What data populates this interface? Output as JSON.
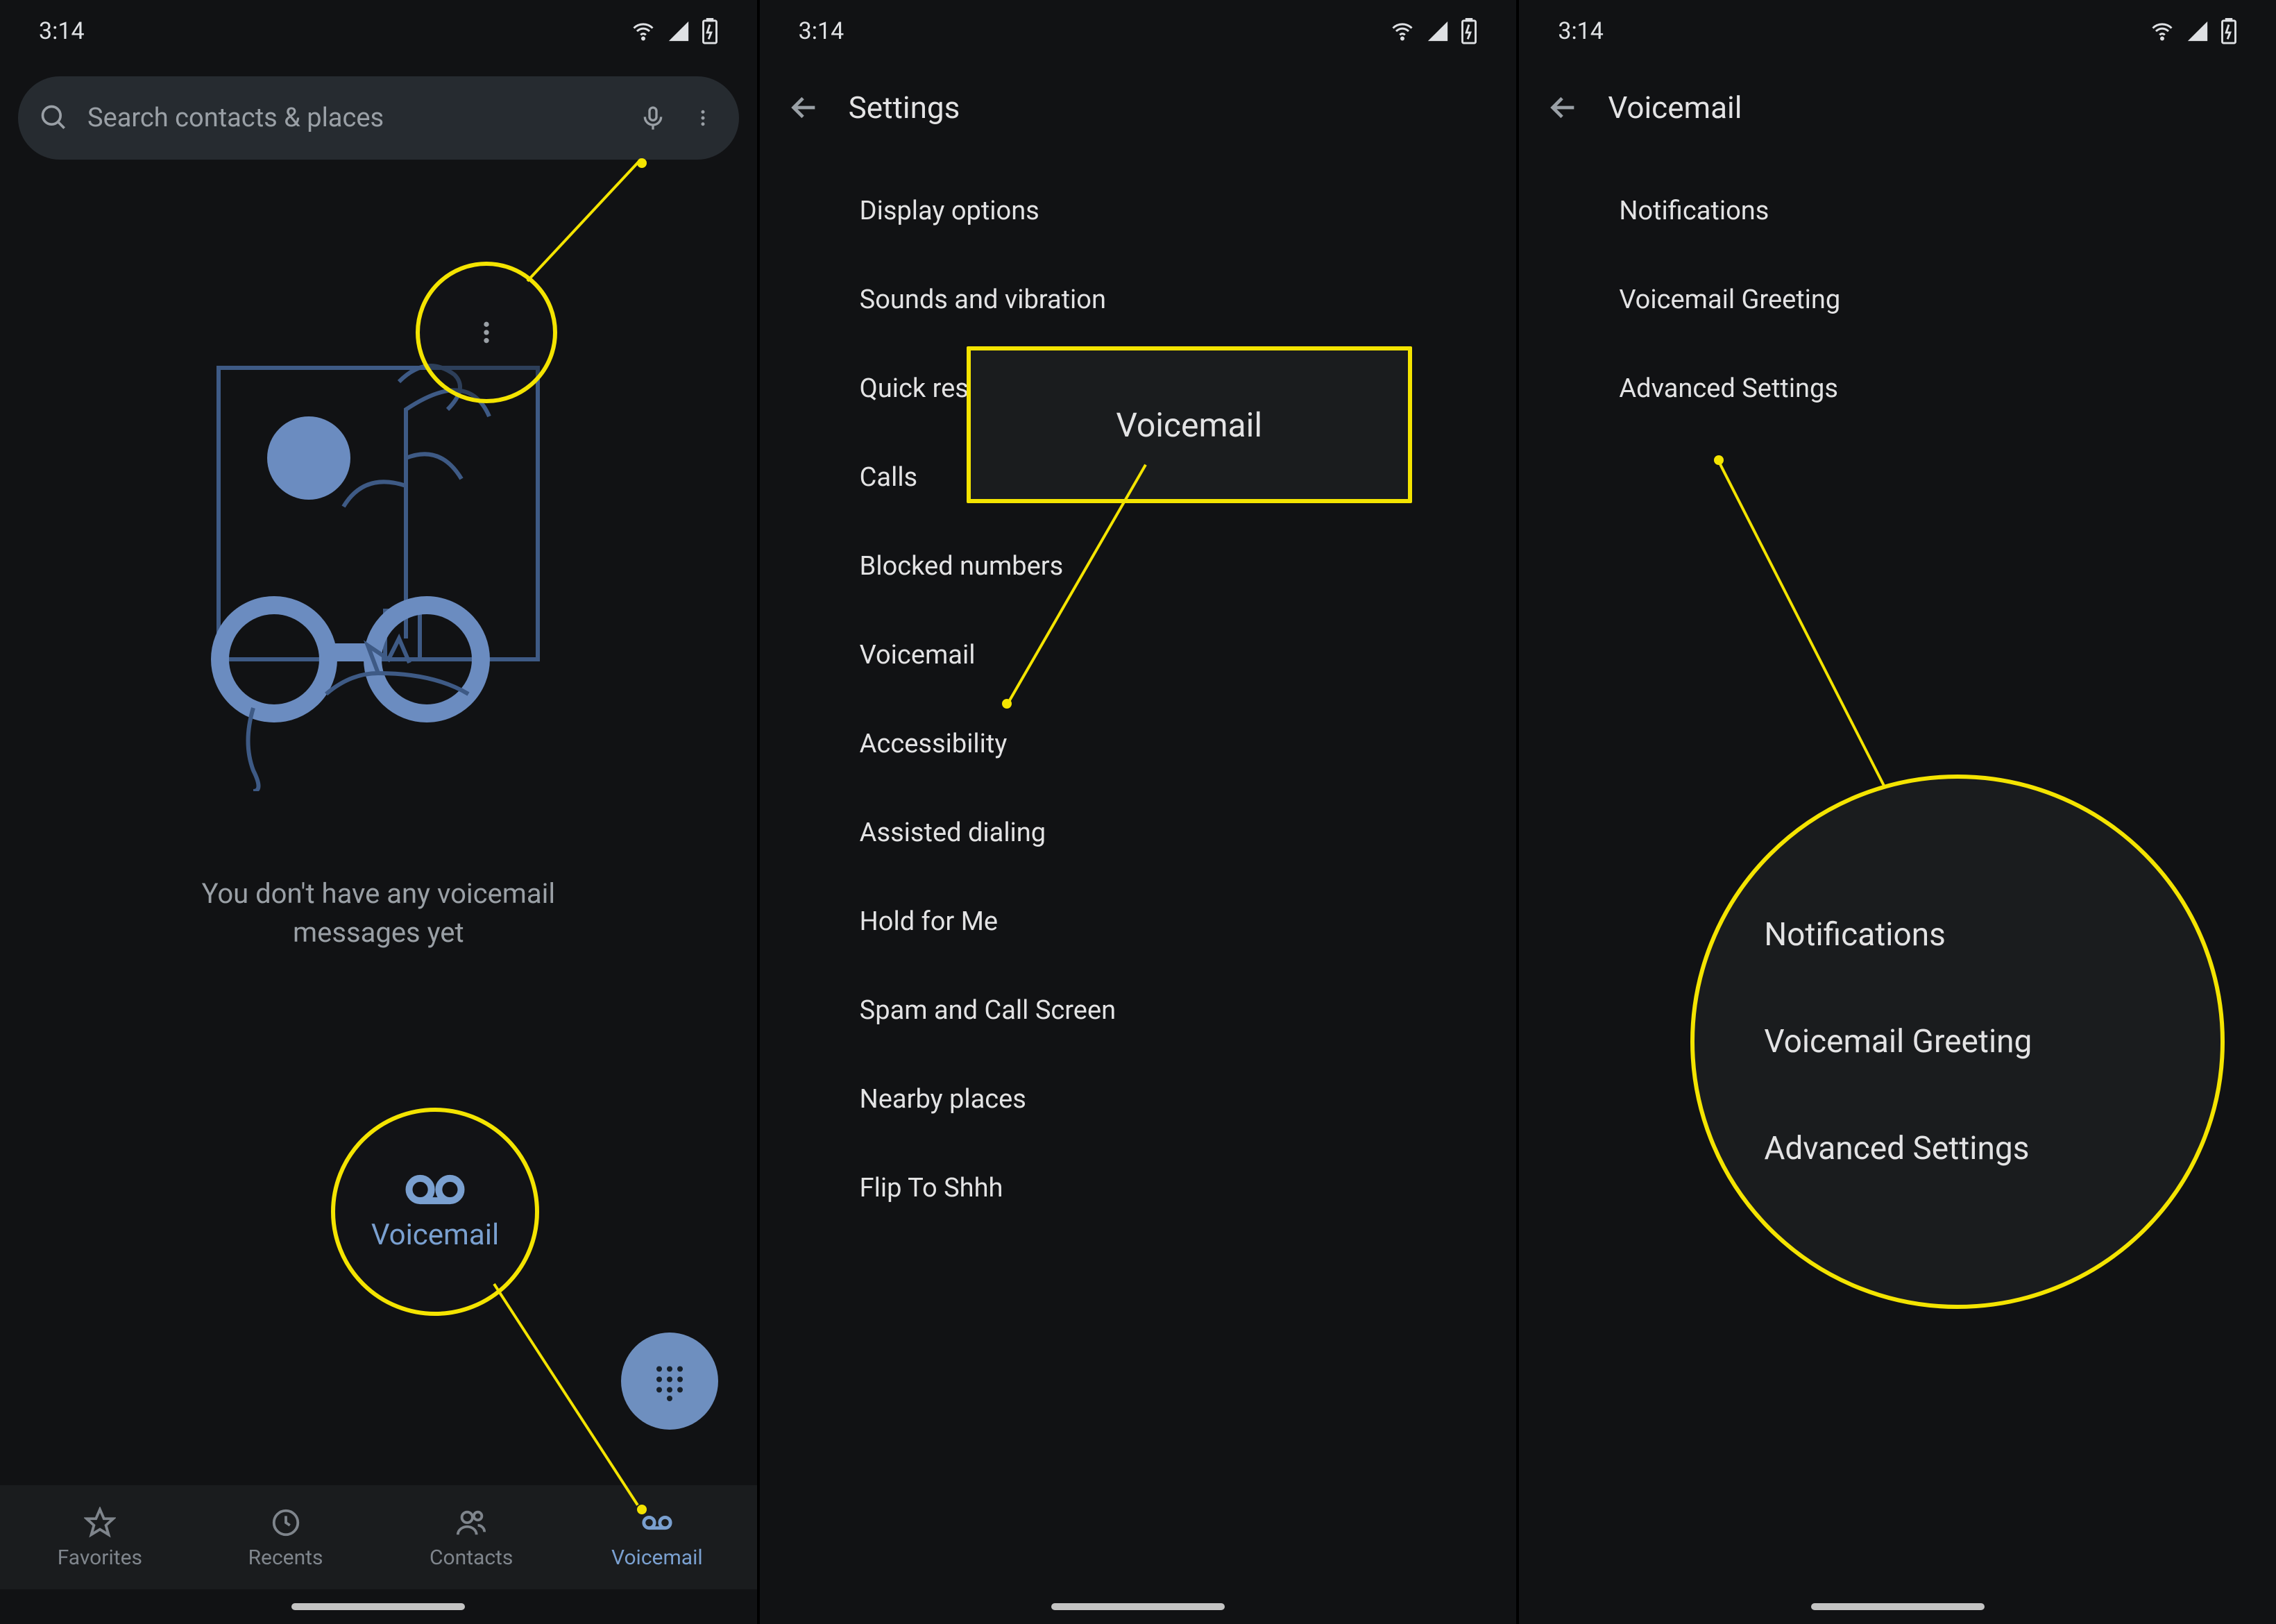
{
  "status": {
    "time": "3:14"
  },
  "screen1": {
    "search_placeholder": "Search contacts & places",
    "empty_message": "You don't have any voicemail messages yet",
    "nav": {
      "favorites": "Favorites",
      "recents": "Recents",
      "contacts": "Contacts",
      "voicemail": "Voicemail"
    }
  },
  "screen2": {
    "title": "Settings",
    "items": [
      "Display options",
      "Sounds and vibration",
      "Quick responses",
      "Calls",
      "Blocked numbers",
      "Voicemail",
      "Accessibility",
      "Assisted dialing",
      "Hold for Me",
      "Spam and Call Screen",
      "Nearby places",
      "Flip To Shhh"
    ],
    "callout_label": "Voicemail"
  },
  "screen3": {
    "title": "Voicemail",
    "items": [
      "Notifications",
      "Voicemail Greeting",
      "Advanced Settings"
    ],
    "callout_items": [
      "Notifications",
      "Voicemail Greeting",
      "Advanced Settings"
    ]
  }
}
